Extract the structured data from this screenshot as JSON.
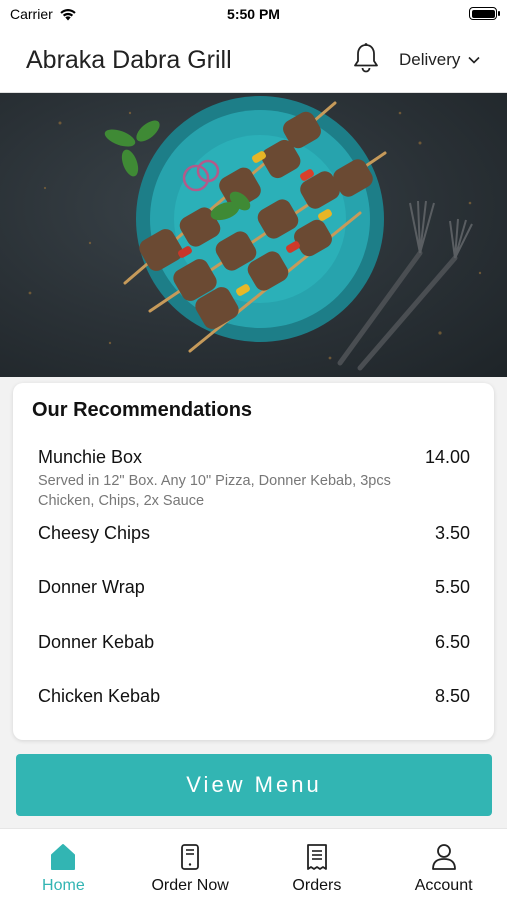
{
  "status_bar": {
    "carrier": "Carrier",
    "time": "5:50 PM"
  },
  "header": {
    "title": "Abraka Dabra Grill",
    "delivery_label": "Delivery"
  },
  "hero": {
    "image_icon": "kebab-skewers-photo"
  },
  "recommendations": {
    "title": "Our Recommendations",
    "items": [
      {
        "name": "Munchie Box",
        "price": "14.00",
        "description": "Served in 12\" Box. Any 10\" Pizza, Donner Kebab, 3pcs Chicken, Chips, 2x Sauce"
      },
      {
        "name": "Cheesy Chips",
        "price": "3.50"
      },
      {
        "name": "Donner Wrap",
        "price": "5.50"
      },
      {
        "name": "Donner Kebab",
        "price": "6.50"
      },
      {
        "name": "Chicken Kebab",
        "price": "8.50"
      }
    ]
  },
  "view_menu_label": "View Menu",
  "tabs": [
    {
      "label": "Home",
      "icon": "home-icon",
      "active": true
    },
    {
      "label": "Order Now",
      "icon": "phone-icon"
    },
    {
      "label": "Orders",
      "icon": "receipt-icon"
    },
    {
      "label": "Account",
      "icon": "user-icon"
    }
  ],
  "colors": {
    "accent": "#32b5b3",
    "hero_bg": "#2a3136"
  }
}
